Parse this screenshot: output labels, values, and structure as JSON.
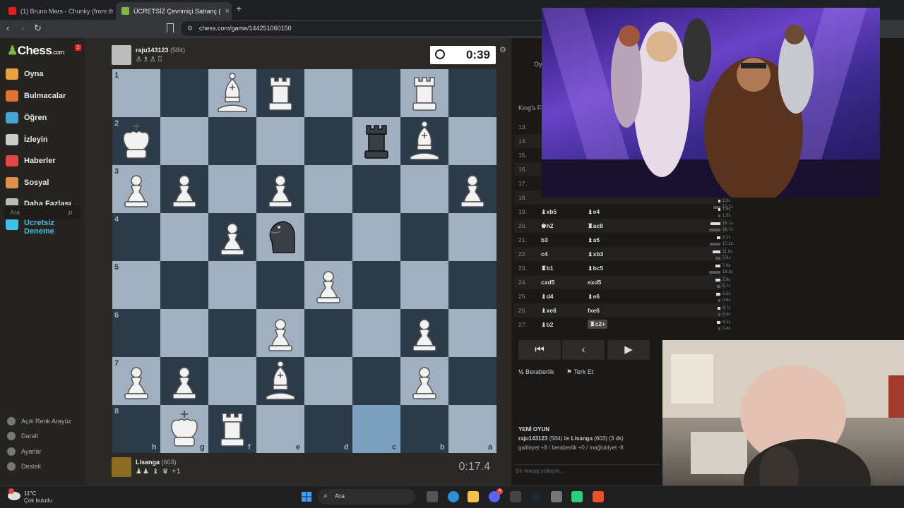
{
  "browser": {
    "tab1_title": "(1) Bruno Mars - Chunky (from th",
    "tab2_title": "ÜCRETSİZ Çevrimiçi Satranç (",
    "url": "chess.com/game/144251060150"
  },
  "sidebar": {
    "logo": "Chess",
    "logo_suffix": ".com",
    "badge": "1",
    "items": [
      {
        "label": "Oyna",
        "color": "#e8a33d"
      },
      {
        "label": "Bulmacalar",
        "color": "#e6712c"
      },
      {
        "label": "Öğren",
        "color": "#46a5d6"
      },
      {
        "label": "İzleyin",
        "color": "#cccccc"
      },
      {
        "label": "Haberler",
        "color": "#e04848"
      },
      {
        "label": "Sosyal",
        "color": "#d8924a"
      },
      {
        "label": "Daha Fazlası",
        "color": "#bbbbbb"
      },
      {
        "label": "Ücretsiz Deneme",
        "color": "#3ec1e8"
      }
    ],
    "search_placeholder": "Ara",
    "settings": [
      "Açık Renk Arayüz",
      "Daralt",
      "Ayarlar",
      "Destek"
    ]
  },
  "game": {
    "top_player": {
      "name": "raju143123",
      "rating": "(584)"
    },
    "top_clock": "0:39",
    "bottom_player": {
      "name": "Lisanga",
      "rating": "(603)"
    },
    "bottom_clock": "0:17.4",
    "bottom_captured": "♟♟ ♝ ♛ +1",
    "top_captured": "♙♗♙♖",
    "ranks": [
      "1",
      "2",
      "3",
      "4",
      "5",
      "6",
      "7",
      "8"
    ],
    "files": [
      "h",
      "g",
      "f",
      "e",
      "d",
      "c",
      "b",
      "a"
    ],
    "pieces": [
      {
        "sq": "f1",
        "type": "B"
      },
      {
        "sq": "e1",
        "type": "R"
      },
      {
        "sq": "b1",
        "type": "R"
      },
      {
        "sq": "h2",
        "type": "K"
      },
      {
        "sq": "c2",
        "type": "Rd"
      },
      {
        "sq": "b2",
        "type": "B"
      },
      {
        "sq": "h3",
        "type": "P"
      },
      {
        "sq": "g3",
        "type": "P"
      },
      {
        "sq": "e3",
        "type": "P"
      },
      {
        "sq": "a3",
        "type": "P"
      },
      {
        "sq": "f4",
        "type": "P"
      },
      {
        "sq": "e4",
        "type": "Nd"
      },
      {
        "sq": "d5",
        "type": "P"
      },
      {
        "sq": "e6",
        "type": "P"
      },
      {
        "sq": "b6",
        "type": "P"
      },
      {
        "sq": "h7",
        "type": "P"
      },
      {
        "sq": "g7",
        "type": "P"
      },
      {
        "sq": "e7",
        "type": "B"
      },
      {
        "sq": "b7",
        "type": "P"
      },
      {
        "sq": "g8",
        "type": "K"
      },
      {
        "sq": "f8",
        "type": "R"
      }
    ],
    "highlight": [
      "c8",
      "c2"
    ]
  },
  "moves": {
    "header": "King's Fi",
    "rows": [
      {
        "n": "13.",
        "w": "",
        "b": ""
      },
      {
        "n": "14.",
        "w": "",
        "b": ""
      },
      {
        "n": "15.",
        "w": "",
        "b": ""
      },
      {
        "n": "16.",
        "w": "",
        "b": ""
      },
      {
        "n": "17.",
        "w": "",
        "b": ""
      },
      {
        "n": "18.",
        "w": "",
        "b": ""
      },
      {
        "n": "19.",
        "w": "♝xb5",
        "b": "♝e4"
      },
      {
        "n": "20.",
        "w": "♚h2",
        "b": "♜ac8"
      },
      {
        "n": "21.",
        "w": "b3",
        "b": "♝a5"
      },
      {
        "n": "22.",
        "w": "c4",
        "b": "♝xb3"
      },
      {
        "n": "23.",
        "w": "♜b1",
        "b": "♝bc5"
      },
      {
        "n": "24.",
        "w": "cxd5",
        "b": "exd5"
      },
      {
        "n": "25.",
        "w": "♝d4",
        "b": "♝e6"
      },
      {
        "n": "26.",
        "w": "♝xe6",
        "b": "fxe6"
      },
      {
        "n": "27.",
        "w": "♝b2",
        "b": "♜c2+"
      }
    ],
    "times": [
      [
        "1.5s",
        "1.5s"
      ],
      [
        "15.1s",
        "18.7s"
      ],
      [
        "6.1s",
        "17.1s"
      ],
      [
        "11.8s",
        "7.9s"
      ],
      [
        "7.6s",
        "19.3s"
      ],
      [
        "7.8s",
        "5.7s"
      ],
      [
        "6.5s",
        "0.6s"
      ],
      [
        "4.7s",
        "0.4s"
      ],
      [
        "6.1s",
        "0.4s"
      ]
    ],
    "partial_times": [
      "1.5s",
      "10.7s"
    ],
    "draw_label": "Beraberlik",
    "resign_label": "Terk Et",
    "half_symbol": "½"
  },
  "new_game": {
    "title": "YENİ OYUN",
    "white": "raju143123",
    "white_rating": "(584)",
    "vs": "ile",
    "black": "Lisanga",
    "black_rating": "(603)",
    "tc": "(3 dk)",
    "result": "galibiyet +8 / beraberlik +0 / mağlubiyet -8"
  },
  "chat_placeholder": "Bir mesaj yollayın...",
  "panel_partial": "Oyu",
  "taskbar": {
    "temp": "11°C",
    "weather": "Çok bulutlu",
    "search": "Ara",
    "notification_badge": "4"
  }
}
